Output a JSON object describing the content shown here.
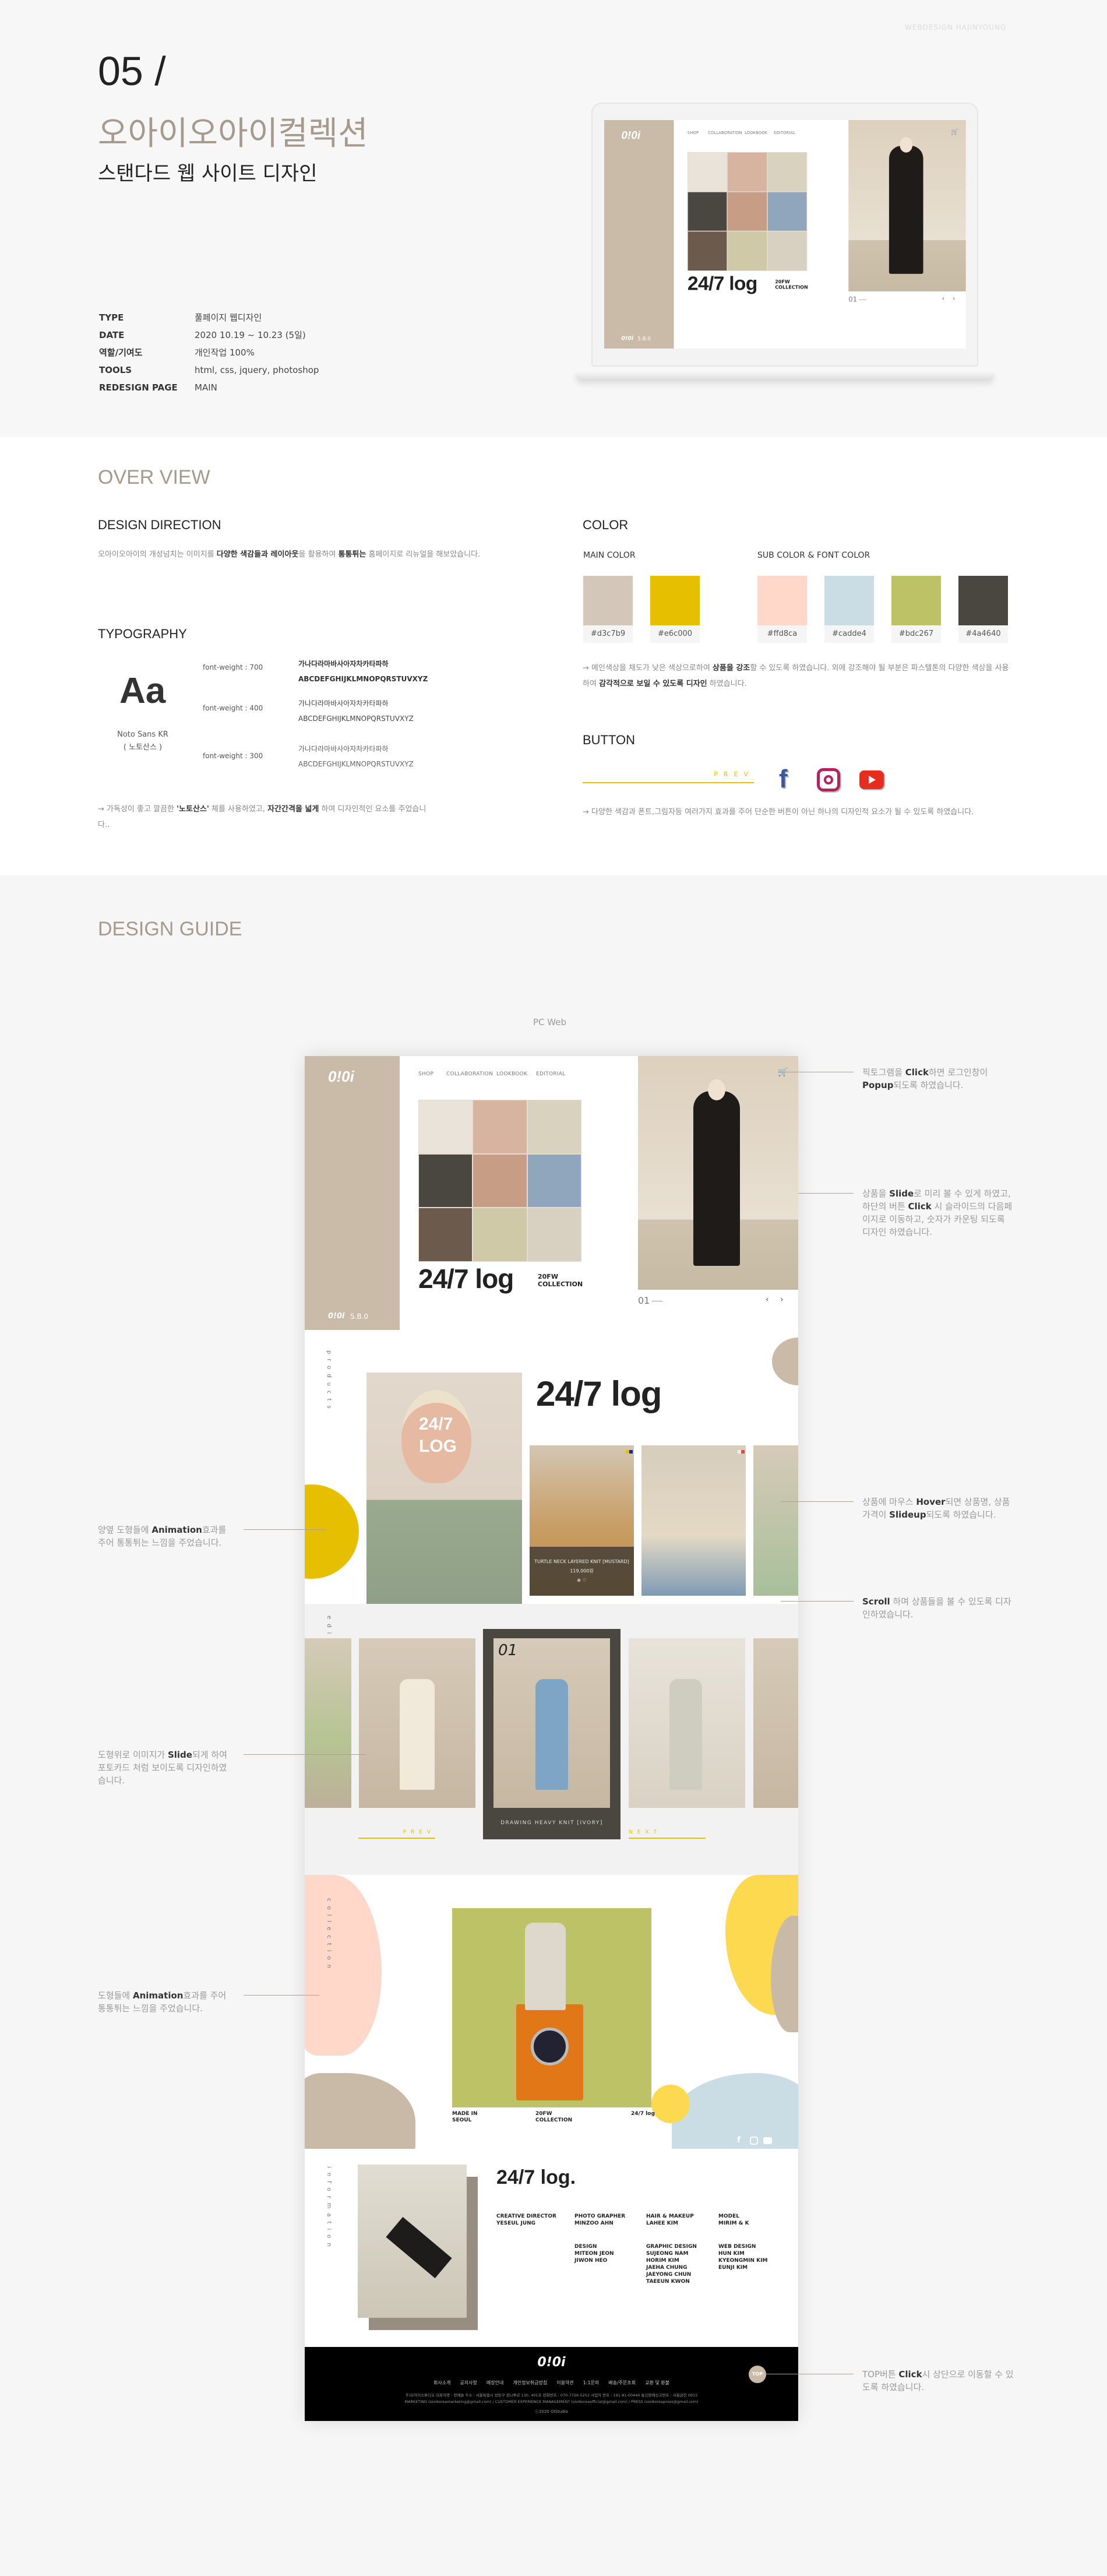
{
  "watermark": "WEBDESIGN HAJINYOUNG",
  "header": {
    "number": "05 /",
    "title": "오아이오아이컬렉션",
    "subtitle": "스탠다드 웹 사이트 디자인",
    "info": [
      {
        "label": "TYPE",
        "value": "풀페이지 웹디자인"
      },
      {
        "label": "DATE",
        "value": "2020 10.19 ~ 10.23 (5일)"
      },
      {
        "label": "역할/기여도",
        "value": "개인작업 100%"
      },
      {
        "label": "TOOLS",
        "value": "html, css, jquery, photoshop"
      },
      {
        "label": "REDESIGN PAGE",
        "value": "MAIN"
      }
    ]
  },
  "site": {
    "logo": "0!0i",
    "nav": [
      "SHOP",
      "COLLABORATION",
      "LOOKBOOK",
      "EDITORIAL"
    ],
    "hero_title": "24/7 log",
    "hero_sub1": "20FW",
    "hero_sub2": "COLLECTION",
    "counter": "01",
    "prev_arrow": "‹",
    "next_arrow": "›",
    "cart_icon": "cart-icon",
    "bottom_logo": "0!0i",
    "bottom_tag": "5.B.0"
  },
  "overview": {
    "title": "OVER VIEW",
    "direction": {
      "title": "DESIGN DIRECTION",
      "text": [
        {
          "t": "오아이오아이의 개성넘치는 이미지를 "
        },
        {
          "t": "다양한 색감들과 레이아웃",
          "b": true
        },
        {
          "t": "을 활용하여 "
        },
        {
          "t": "통통튀는",
          "b": true
        },
        {
          "t": " 홈페이지로 리뉴얼을 해보았습니다."
        }
      ]
    },
    "typography": {
      "title": "TYPOGRAPHY",
      "sample": "Aa",
      "font_name": "Noto Sans KR",
      "font_name_ko": "( 노토산스 )",
      "weights": [
        {
          "label": "font-weight : 700",
          "ko": "가나다라마바사아자차카타파하",
          "en": "ABCDEFGHIJKLMNOPQRSTUVXYZ"
        },
        {
          "label": "font-weight : 400",
          "ko": "가나다라마바사아자차카타파하",
          "en": "ABCDEFGHIJKLMNOPQRSTUVXYZ"
        },
        {
          "label": "font-weight : 300",
          "ko": "가나다라마바사아자차카타파하",
          "en": "ABCDEFGHIJKLMNOPQRSTUVXYZ"
        }
      ],
      "note": [
        {
          "t": "→ 가독성이 좋고 깔끔한 "
        },
        {
          "t": "'노토산스'",
          "b": true
        },
        {
          "t": " 체를 사용하였고, "
        },
        {
          "t": "자간간격을 넓게",
          "b": true
        },
        {
          "t": " 하여 디자인적인 요소를 주었습니다.."
        }
      ]
    },
    "color": {
      "title": "COLOR",
      "main_label": "MAIN COLOR",
      "sub_label": "SUB COLOR & FONT COLOR",
      "main": [
        "#d3c7b9",
        "#e6c000"
      ],
      "sub": [
        "#ffd8ca",
        "#cadde4",
        "#bdc267",
        "#4a4640"
      ],
      "note": [
        {
          "t": "→ 메인색상을 채도가 낮은 색상으로하여 "
        },
        {
          "t": "상품을 강조",
          "b": true
        },
        {
          "t": "할 수 있도록 하였습니다. 외에 강조해야 될 부분은 파스텔톤의 다양한 색상을 사용하여 "
        },
        {
          "t": "감각적으로 보일 수 있도록 디자인",
          "b": true
        },
        {
          "t": " 하였습니다."
        }
      ]
    },
    "button": {
      "title": "BUTTON",
      "prev": "PREV",
      "icons": [
        "facebook-icon",
        "instagram-icon",
        "youtube-icon"
      ],
      "note": [
        {
          "t": "→ 다양한 색감과 폰트,그림자등 여러가지 효과를 주어 단순한 버튼이 아닌 하나의 디자인적 요소가 될 수 있도록 하였습니다."
        }
      ]
    }
  },
  "guide": {
    "title": "DESIGN GUIDE",
    "device": "PC Web",
    "annotations": {
      "popup": [
        {
          "t": "픽토그램을 "
        },
        {
          "t": "Click",
          "b": true
        },
        {
          "t": "하면 로그인창이 "
        },
        {
          "t": "Popup",
          "b": true
        },
        {
          "t": "되도록 하였습니다."
        }
      ],
      "slide": [
        {
          "t": "상품을 "
        },
        {
          "t": "Slide",
          "b": true
        },
        {
          "t": "로 미리 볼 수 있게 하였고, 하단의 버튼 "
        },
        {
          "t": "Click",
          "b": true
        },
        {
          "t": " 시 슬라이드의 다음페이지로 이동하고, 숫자가 카운팅 되도록  디자인 하였습니다."
        }
      ],
      "hover": [
        {
          "t": "상품에 마우스 "
        },
        {
          "t": "Hover",
          "b": true
        },
        {
          "t": "되면 상품명, 상품가격이 "
        },
        {
          "t": "Slideup",
          "b": true
        },
        {
          "t": "되도록 하였습니다."
        }
      ],
      "scroll": [
        {
          "t": "Scroll",
          "b": true
        },
        {
          "t": " 하며  상품들을 볼 수 있도록 디자인하였습니다."
        }
      ],
      "shapes": [
        {
          "t": "양옆 도형들에 "
        },
        {
          "t": "Animation",
          "b": true
        },
        {
          "t": "효과를 주어 통통튀는 느낌을 주었습니다."
        }
      ],
      "photocard": [
        {
          "t": "도형위로 이미지가 "
        },
        {
          "t": "Slide",
          "b": true
        },
        {
          "t": "되게 하여 포토카드 처럼 보이도록  디자인하였습니다."
        }
      ],
      "blobs": [
        {
          "t": "도형들에 "
        },
        {
          "t": "Animation",
          "b": true
        },
        {
          "t": "효과를 주어 통통튀는 느낌을 주었습니다."
        }
      ],
      "top": [
        {
          "t": "TOP버튼 "
        },
        {
          "t": "Click",
          "b": true
        },
        {
          "t": "시 상단으로 이동할 수 있도록 하였습니다."
        }
      ]
    }
  },
  "products": {
    "label": "products",
    "title": "24/7 log",
    "overlay_letters": "24/7 LOG",
    "item_name": "TURTLE NECK LAYERED KNIT [MUSTARD]",
    "item_price": "119,000원"
  },
  "editorial": {
    "label": "editorial",
    "number": "01",
    "item_name": "DRAWING HEAVY KNIT [IVORY]",
    "prev": "PREV",
    "next": "NEXT"
  },
  "collection": {
    "label": "collection",
    "caption1": "MADE IN SEOUL",
    "caption2": "20FW COLLECTION",
    "caption3": "24/7 log"
  },
  "information": {
    "label": "information",
    "title": "24/7 log.",
    "credits": [
      {
        "role": "CREATIVE DIRECTOR",
        "names": "YESEUL JUNG"
      },
      {
        "role": "PHOTO GRAPHER",
        "names": "MINZOO AHN"
      },
      {
        "role": "HAIR & MAKEUP",
        "names": "LAHEE KIM"
      },
      {
        "role": "MODEL",
        "names": "MIRIM & K"
      },
      {
        "role": "DESIGN",
        "names": "MITEON JEON\nJIWON HEO"
      },
      {
        "role": "GRAPHIC DESIGN",
        "names": "SUJEONG NAM\nHORIM KIM\nJAEHA CHUNG\nJAEYONG CHUN\nTAEEUN KWON"
      },
      {
        "role": "WEB DESIGN",
        "names": "HUN KIM\nKYEONGMIN KIM\nEUNJI KIM"
      }
    ]
  },
  "footer": {
    "logo": "0!0i",
    "links": [
      "회사소개",
      "공지사항",
      "매장안내",
      "개인정보취급방침",
      "이용약관",
      "1:1문의",
      "배송/주문조회",
      "교환 및 환불"
    ],
    "address": "주)오아이스튜디오 대표자명 : 정예슬 주소 : 서울특별시 성동구 광나루로 130, 401호 전화번호 : 070-7726-5252 사업자 번호 : 191-81-00440 통신판매신고번호 : 서울금천 0915",
    "contacts": "MARKETING (oioikoreamarketing@gmail.com) / CUSTOMER EXPERIENCE MANAGEMENT (oioikoreaofficial@gmail.com) / PRESS (oioikoreapress@gmail.com)",
    "copyright": "ⓒ2020 OIStudio",
    "top": "TOP"
  }
}
